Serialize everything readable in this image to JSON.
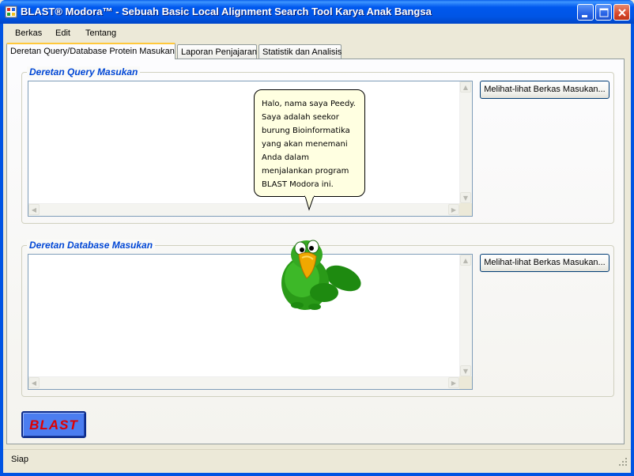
{
  "window": {
    "title": "BLAST® Modora™ - Sebuah Basic Local Alignment Search Tool Karya Anak Bangsa",
    "controls": [
      "minimize-icon",
      "maximize-icon",
      "close-icon"
    ]
  },
  "menu": {
    "items": [
      "Berkas",
      "Edit",
      "Tentang"
    ]
  },
  "tabs": [
    {
      "label": "Deretan Query/Database Protein Masukan",
      "active": true
    },
    {
      "label": "Laporan Penjajaran",
      "active": false
    },
    {
      "label": "Statistik dan Analisis",
      "active": false
    }
  ],
  "query_group": {
    "title": "Deretan Query Masukan",
    "value": "",
    "browse_label": "Melihat-lihat Berkas Masukan..."
  },
  "database_group": {
    "title": "Deretan Database Masukan",
    "value": "",
    "browse_label": "Melihat-lihat Berkas Masukan..."
  },
  "assistant": {
    "balloon_lines": [
      "Halo, nama saya Peedy.",
      "Saya adalah seekor",
      "burung Bioinformatika",
      "yang akan menemani",
      "Anda dalam",
      "menjalankan program",
      "BLAST Modora ini."
    ],
    "character": "parrot-icon"
  },
  "action": {
    "blast_label": "BLAST"
  },
  "status": {
    "text": "Siap"
  },
  "colors": {
    "titlebar": "#0054E3",
    "group_title": "#0046D5",
    "blast_button": "#4B7DF0",
    "blast_text": "#E00000",
    "balloon": "#FFFFE1"
  }
}
